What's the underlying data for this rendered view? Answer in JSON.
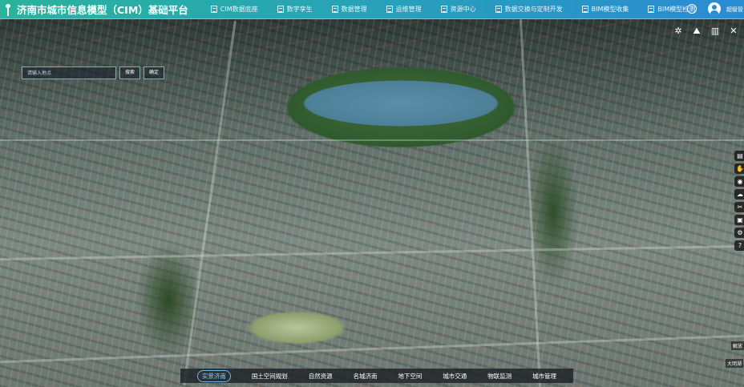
{
  "header": {
    "title": "济南市城市信息模型（CIM）基础平台",
    "nav": [
      "CIM数据底座",
      "数字孪生",
      "数据管理",
      "运维管理",
      "资源中心",
      "数据交换与定制开发",
      "BIM模型收集",
      "BIM模型检测"
    ],
    "help": "?",
    "user": "超级管"
  },
  "toolbar": {
    "icons": [
      "gear-icon",
      "mountain-icon",
      "building-icon",
      "measure-icon"
    ]
  },
  "search": {
    "placeholder": "请输入地点",
    "search_label": "搜索",
    "confirm_label": "确定"
  },
  "sidebar": {
    "icons": [
      "layer-icon",
      "hand-icon",
      "camera-icon",
      "weather-icon",
      "tool-icon",
      "screenshot-icon",
      "settings-icon",
      "help-icon"
    ],
    "glyphs": [
      "▤",
      "✋",
      "◉",
      "☁",
      "✂",
      "▣",
      "⚙",
      "?"
    ]
  },
  "bottom_nav": {
    "items": [
      "实景济南",
      "国土空间规划",
      "自然资源",
      "名城济南",
      "地下空间",
      "城市交通",
      "物联监测",
      "城市管理"
    ],
    "active": 0
  },
  "map_labels": [
    "解放",
    "大明湖"
  ],
  "colors": {
    "header_start": "#2ab39d",
    "header_end": "#2a8bd3",
    "active": "#8fd0ff"
  }
}
